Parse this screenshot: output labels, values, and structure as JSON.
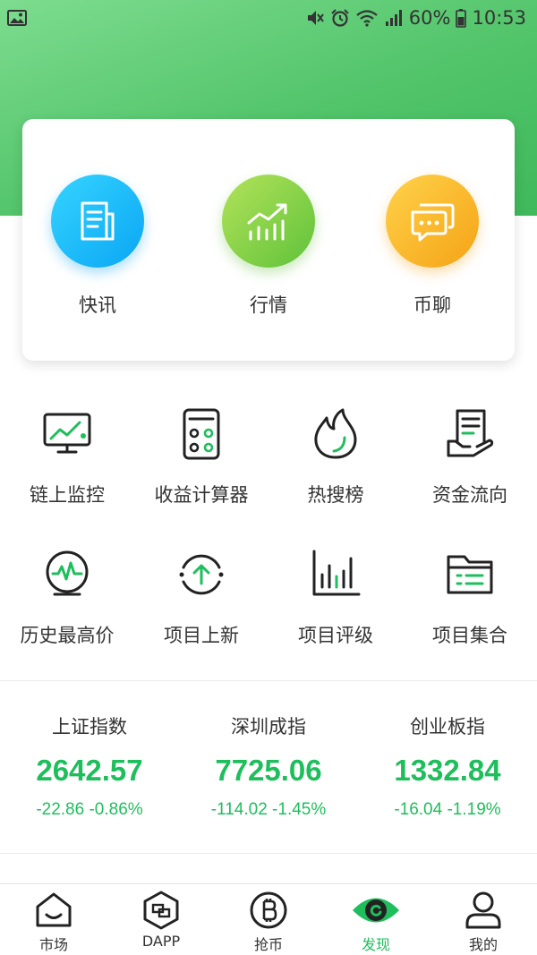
{
  "status_bar": {
    "battery": "60%",
    "time": "10:53"
  },
  "featured": [
    {
      "label": "快讯",
      "icon": "news-icon",
      "color": "#0aa6f4"
    },
    {
      "label": "行情",
      "icon": "market-chart-icon",
      "color": "#5fc23a"
    },
    {
      "label": "币聊",
      "icon": "chat-icon",
      "color": "#f5a316"
    }
  ],
  "tools": [
    {
      "label": "链上监控",
      "icon": "monitor-icon"
    },
    {
      "label": "收益计算器",
      "icon": "calculator-icon"
    },
    {
      "label": "热搜榜",
      "icon": "flame-icon"
    },
    {
      "label": "资金流向",
      "icon": "fund-flow-icon"
    },
    {
      "label": "历史最高价",
      "icon": "highest-price-icon"
    },
    {
      "label": "项目上新",
      "icon": "new-project-icon"
    },
    {
      "label": "项目评级",
      "icon": "rating-chart-icon"
    },
    {
      "label": "项目集合",
      "icon": "folder-icon"
    }
  ],
  "indices": [
    {
      "name": "上证指数",
      "value": "2642.57",
      "change": "-22.86 -0.86%"
    },
    {
      "name": "深圳成指",
      "value": "7725.06",
      "change": "-114.02 -1.45%"
    },
    {
      "name": "创业板指",
      "value": "1332.84",
      "change": "-16.04 -1.19%"
    }
  ],
  "tabbar": [
    {
      "label": "市场",
      "icon": "market-icon",
      "active": false
    },
    {
      "label": "DAPP",
      "icon": "dapp-icon",
      "active": false
    },
    {
      "label": "抢币",
      "icon": "bitcoin-icon",
      "active": false
    },
    {
      "label": "发现",
      "icon": "discover-eye-icon",
      "active": true
    },
    {
      "label": "我的",
      "icon": "profile-icon",
      "active": false
    }
  ],
  "colors": {
    "accent": "#1fbe5c",
    "header_gradient_start": "#7ddc8f",
    "header_gradient_end": "#3fb95b"
  }
}
